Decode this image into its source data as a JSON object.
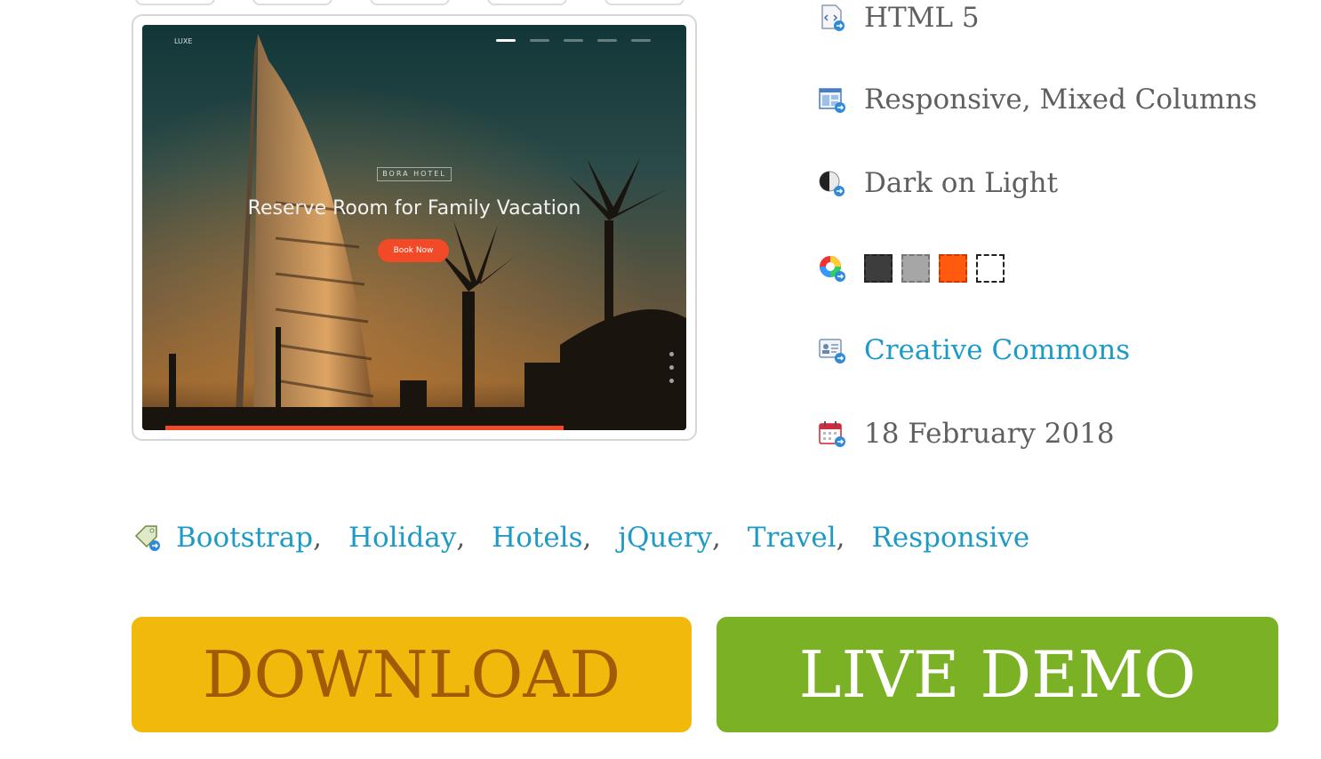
{
  "preview": {
    "brand": "LUXE",
    "subtitle": "BORA HOTEL",
    "headline": "Reserve Room for Family Vacation",
    "cta": "Book Now",
    "alt": "Hotel template preview"
  },
  "features": {
    "html": "HTML 5",
    "layout": "Responsive, Mixed Columns",
    "theme": "Dark on Light",
    "license": "Creative Commons",
    "date": "18 February 2018"
  },
  "colors": [
    "#3d3d3d",
    "#a6a6a6",
    "#ff5a0e",
    "#ffffff"
  ],
  "tags": [
    "Bootstrap",
    "Holiday",
    "Hotels",
    "jQuery",
    "Travel",
    "Responsive"
  ],
  "tag_separator": ",",
  "buttons": {
    "download": "DOWNLOAD",
    "demo": "LIVE DEMO"
  },
  "accent": {
    "link": "#1d9bc6",
    "download_bg": "#f0b90b",
    "download_text": "#a15a05",
    "demo_bg": "#7bb124"
  }
}
